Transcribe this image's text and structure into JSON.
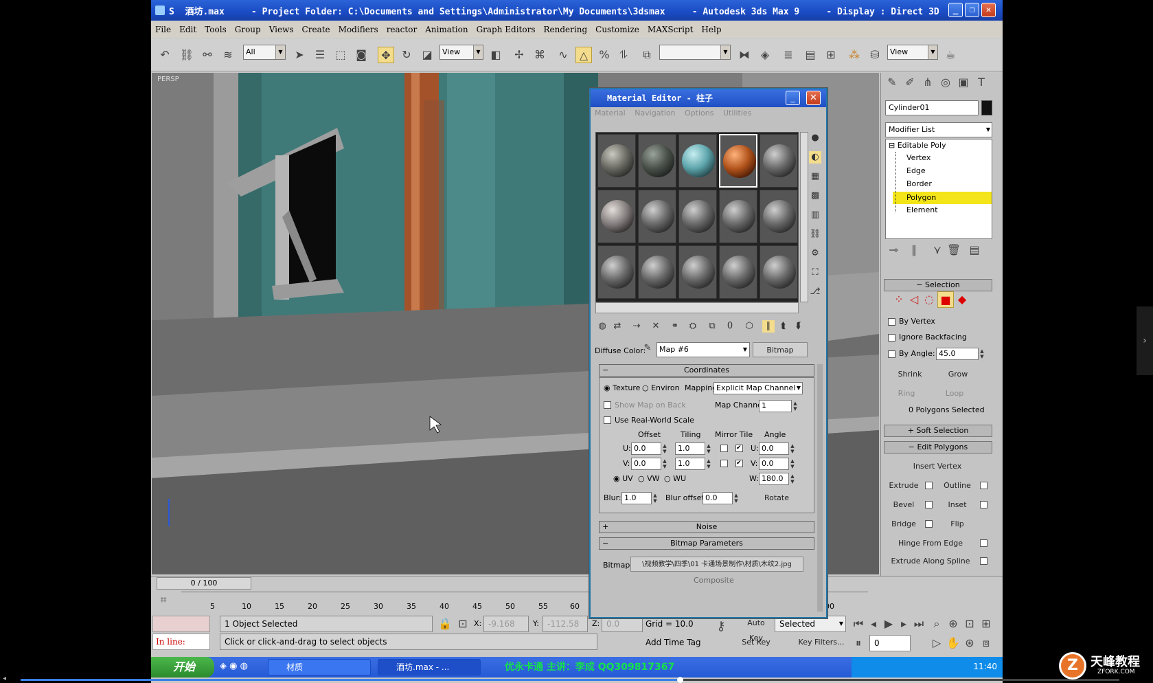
{
  "window": {
    "title": "S  酒坊.max     - Project Folder: C:\\Documents and Settings\\Administrator\\My Documents\\3dsmax     - Autodesk 3ds Max 9     - Display : Direct 3D"
  },
  "menu": [
    "File",
    "Edit",
    "Tools",
    "Group",
    "Views",
    "Create",
    "Modifiers",
    "reactor",
    "Animation",
    "Graph Editors",
    "Rendering",
    "Customize",
    "MAXScript",
    "Help"
  ],
  "toolbar": {
    "selection_filter": "All",
    "ref_coord": "View",
    "named_sel": "",
    "render_view": "View"
  },
  "viewport": {
    "label": "PERSP"
  },
  "material_editor": {
    "title": "Material Editor - 柱子",
    "menu": [
      "Material",
      "Navigation",
      "Options",
      "Utilities"
    ],
    "diffuse_label": "Diffuse Color:",
    "map_name": "Map #6",
    "map_type": "Bitmap",
    "rollouts": {
      "coordinates": "Coordinates",
      "noise": "Noise",
      "bitmap_params": "Bitmap Parameters",
      "composite": "Composite"
    },
    "coords": {
      "texture": "Texture",
      "environ": "Environ",
      "mapping_label": "Mapping:",
      "mapping_value": "Explicit Map Channel",
      "show_map_on_back": "Show Map on Back",
      "map_channel_label": "Map Channel:",
      "map_channel": "1",
      "real_world": "Use Real-World Scale",
      "offset": "Offset",
      "tiling": "Tiling",
      "mirror_tile": "Mirror Tile",
      "angle": "Angle",
      "u_offset": "0.0",
      "v_offset": "0.0",
      "u_tiling": "1.0",
      "v_tiling": "1.0",
      "u_angle": "0.0",
      "v_angle": "0.0",
      "w_angle": "180.0",
      "uv": "UV",
      "vw": "VW",
      "wu": "WU",
      "blur_label": "Blur:",
      "blur": "1.0",
      "blur_offset_label": "Blur offset:",
      "blur_offset": "0.0",
      "rotate": "Rotate"
    },
    "bitmap_label": "Bitmap:",
    "bitmap_path": "\\视频教学\\四季\\01 卡通场景制作\\材质\\木纹2.jpg"
  },
  "command_panel": {
    "object_name": "Cylinder01",
    "object_color": "#111111",
    "modifier_list": "Modifier List",
    "stack": [
      "Editable Poly",
      "Vertex",
      "Edge",
      "Border",
      "Polygon",
      "Element"
    ],
    "stack_selected": 4,
    "selection": {
      "title": "Selection",
      "by_vertex": "By Vertex",
      "ignore_backfacing": "Ignore Backfacing",
      "by_angle": "By Angle:",
      "angle_value": "45.0",
      "shrink": "Shrink",
      "grow": "Grow",
      "ring": "Ring",
      "loop": "Loop",
      "status": "0 Polygons Selected"
    },
    "soft_selection": "Soft Selection",
    "edit_polygons": "Edit Polygons",
    "insert_vertex": "Insert Vertex",
    "extrude": "Extrude",
    "outline": "Outline",
    "bevel": "Bevel",
    "inset": "Inset",
    "bridge": "Bridge",
    "flip": "Flip",
    "hinge": "Hinge From Edge",
    "extrude_spline": "Extrude Along Spline"
  },
  "timeline": {
    "frame_counter": "0 / 100",
    "ticks": [
      "5",
      "10",
      "15",
      "20",
      "25",
      "30",
      "35",
      "40",
      "45",
      "50",
      "55",
      "60",
      "100"
    ]
  },
  "status": {
    "selected": "1 Object Selected",
    "prompt": "Click or click-and-drag to select objects",
    "x_label": "X:",
    "x_value": "-9.168",
    "y_label": "Y:",
    "y_value": "-112.58",
    "z_label": "Z:",
    "z_value": "0.0",
    "grid": "Grid = 10.0",
    "add_time_tag": "Add Time Tag",
    "auto_key": "Auto Key",
    "set_key": "Set Key",
    "selected_drop": "Selected",
    "key_filters": "Key Filters...",
    "frame": "0",
    "maxscript_label": "In line:"
  },
  "taskbar": {
    "start": "开始",
    "tasks": [
      "材质",
      "酒坊.max - ..."
    ],
    "marquee": "优永卡通  主讲：李成 QQ309817367",
    "clock": "11:40"
  },
  "video": {
    "progress": 0.6
  },
  "watermark": {
    "text": "天峰教程",
    "sub": "ZFORK.COM"
  }
}
